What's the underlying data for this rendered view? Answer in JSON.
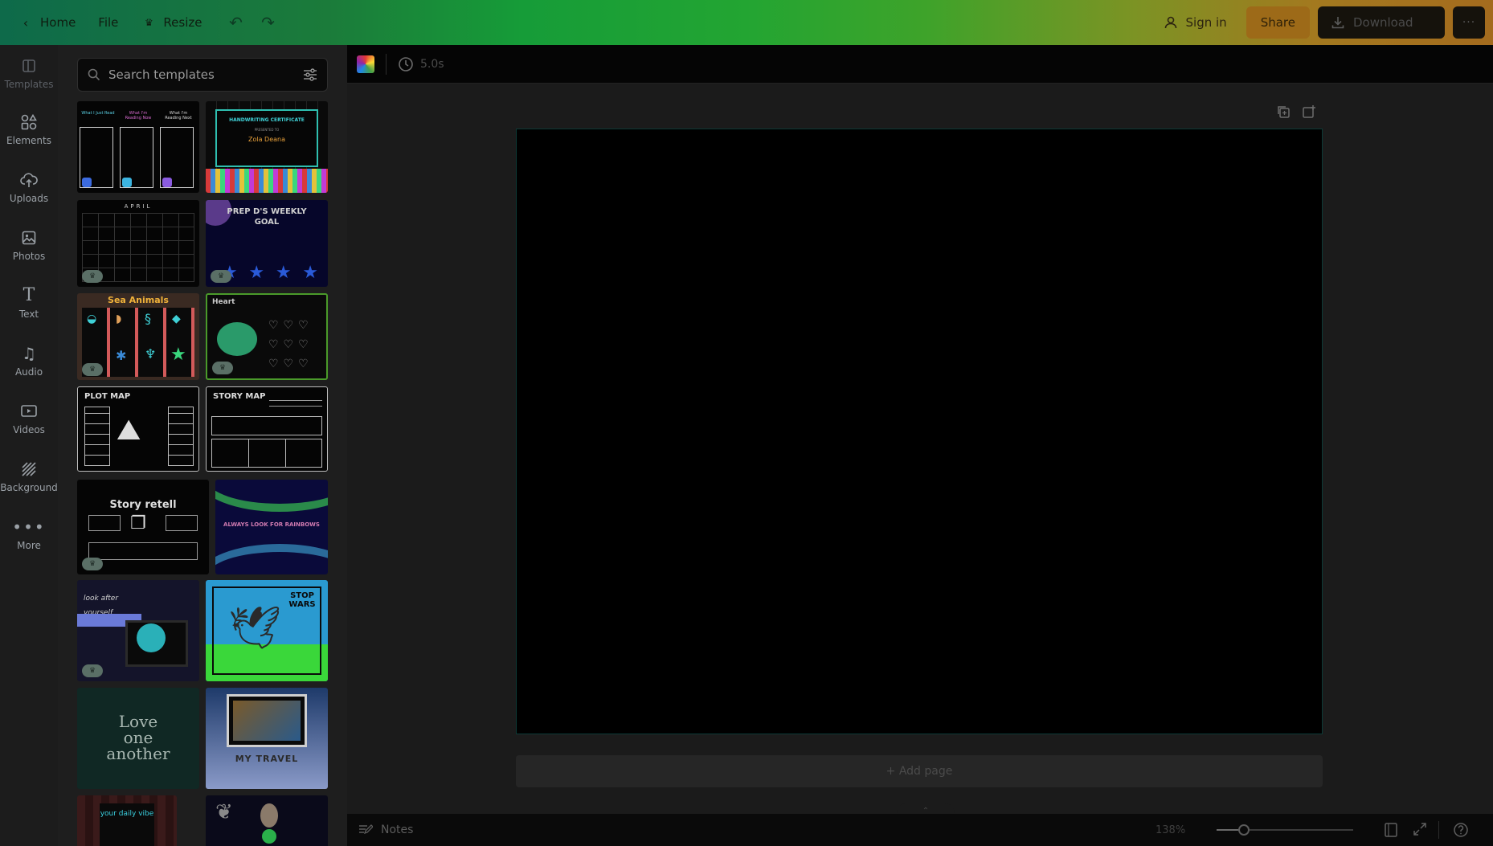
{
  "topbar": {
    "home_label": "Home",
    "file_label": "File",
    "resize_label": "Resize",
    "sign_in_label": "Sign in",
    "share_label": "Share",
    "download_label": "Download",
    "more_label": "···"
  },
  "rail": {
    "items": [
      {
        "label": "Templates",
        "icon": "templates-icon"
      },
      {
        "label": "Elements",
        "icon": "elements-icon"
      },
      {
        "label": "Uploads",
        "icon": "uploads-icon"
      },
      {
        "label": "Photos",
        "icon": "photos-icon"
      },
      {
        "label": "Text",
        "icon": "text-icon"
      },
      {
        "label": "Audio",
        "icon": "audio-icon"
      },
      {
        "label": "Videos",
        "icon": "videos-icon"
      },
      {
        "label": "Background",
        "icon": "background-icon"
      },
      {
        "label": "More",
        "icon": "more-icon"
      }
    ]
  },
  "panel": {
    "search_placeholder": "Search templates",
    "templates": [
      {
        "title": "",
        "lines": [
          "What I Just Read",
          "What I'm Reading Now",
          "What I'm Reading Next"
        ]
      },
      {
        "title": "HANDWRITING CERTIFICATE",
        "lines": [
          "PRESENTED TO",
          "Zola Deana"
        ]
      },
      {
        "title": "APRIL",
        "lines": []
      },
      {
        "title": "PREP D'S WEEKLY GOAL",
        "lines": []
      },
      {
        "title": "Sea Animals",
        "lines": []
      },
      {
        "title": "Heart",
        "lines": []
      },
      {
        "title": "PLOT MAP",
        "lines": []
      },
      {
        "title": "STORY MAP",
        "lines": []
      },
      {
        "title": "Story retell",
        "lines": []
      },
      {
        "title": "ALWAYS LOOK FOR RAINBOWS",
        "lines": []
      },
      {
        "title": "look after yourself",
        "lines": []
      },
      {
        "title": "STOP WARS",
        "lines": []
      },
      {
        "title": "Love one another",
        "lines": []
      },
      {
        "title": "MY TRAVEL",
        "lines": []
      },
      {
        "title": "your daily vibe",
        "lines": []
      },
      {
        "title": "",
        "lines": []
      }
    ]
  },
  "editor": {
    "duration": "5.0s",
    "add_page_label": "+ Add page",
    "notes_label": "Notes",
    "zoom_percent": "138%",
    "zoom_fraction": 0.2
  }
}
